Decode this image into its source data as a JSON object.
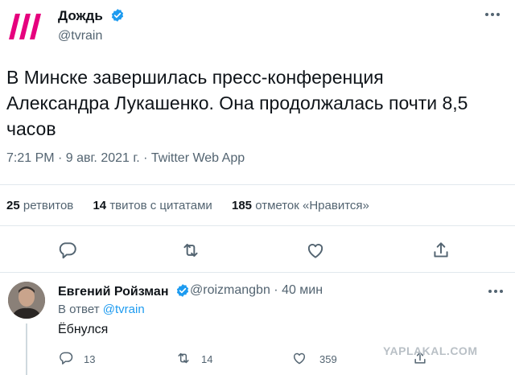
{
  "tweet": {
    "author_name": "Дождь",
    "author_handle": "@tvrain",
    "brand_color": "#e6007e",
    "verified_color": "#1d9bf0",
    "text": "В Минске завершилась пресс-конференция Александра Лукашенко. Она продолжалась почти 8,5 часов",
    "meta": "7:21 PM · 9 авг. 2021 г. · Twitter Web App",
    "stats": {
      "retweets_count": "25",
      "retweets_label": "ретвитов",
      "quotes_count": "14",
      "quotes_label": "твитов с цитатами",
      "likes_count": "185",
      "likes_label": "отметок «Нравится»"
    },
    "actions": [
      "reply-icon",
      "retweet-icon",
      "like-icon",
      "share-icon"
    ]
  },
  "reply": {
    "author_name": "Евгений Ройзман",
    "author_handle": "@roizmangbn · 40 мин",
    "reply_to_prefix": "В ответ",
    "reply_to_mention": "@tvrain",
    "text": "Ёбнулся",
    "reply_count": "13",
    "retweet_count": "14",
    "like_count": "359"
  },
  "watermark": "YAPLAKAL.COM"
}
